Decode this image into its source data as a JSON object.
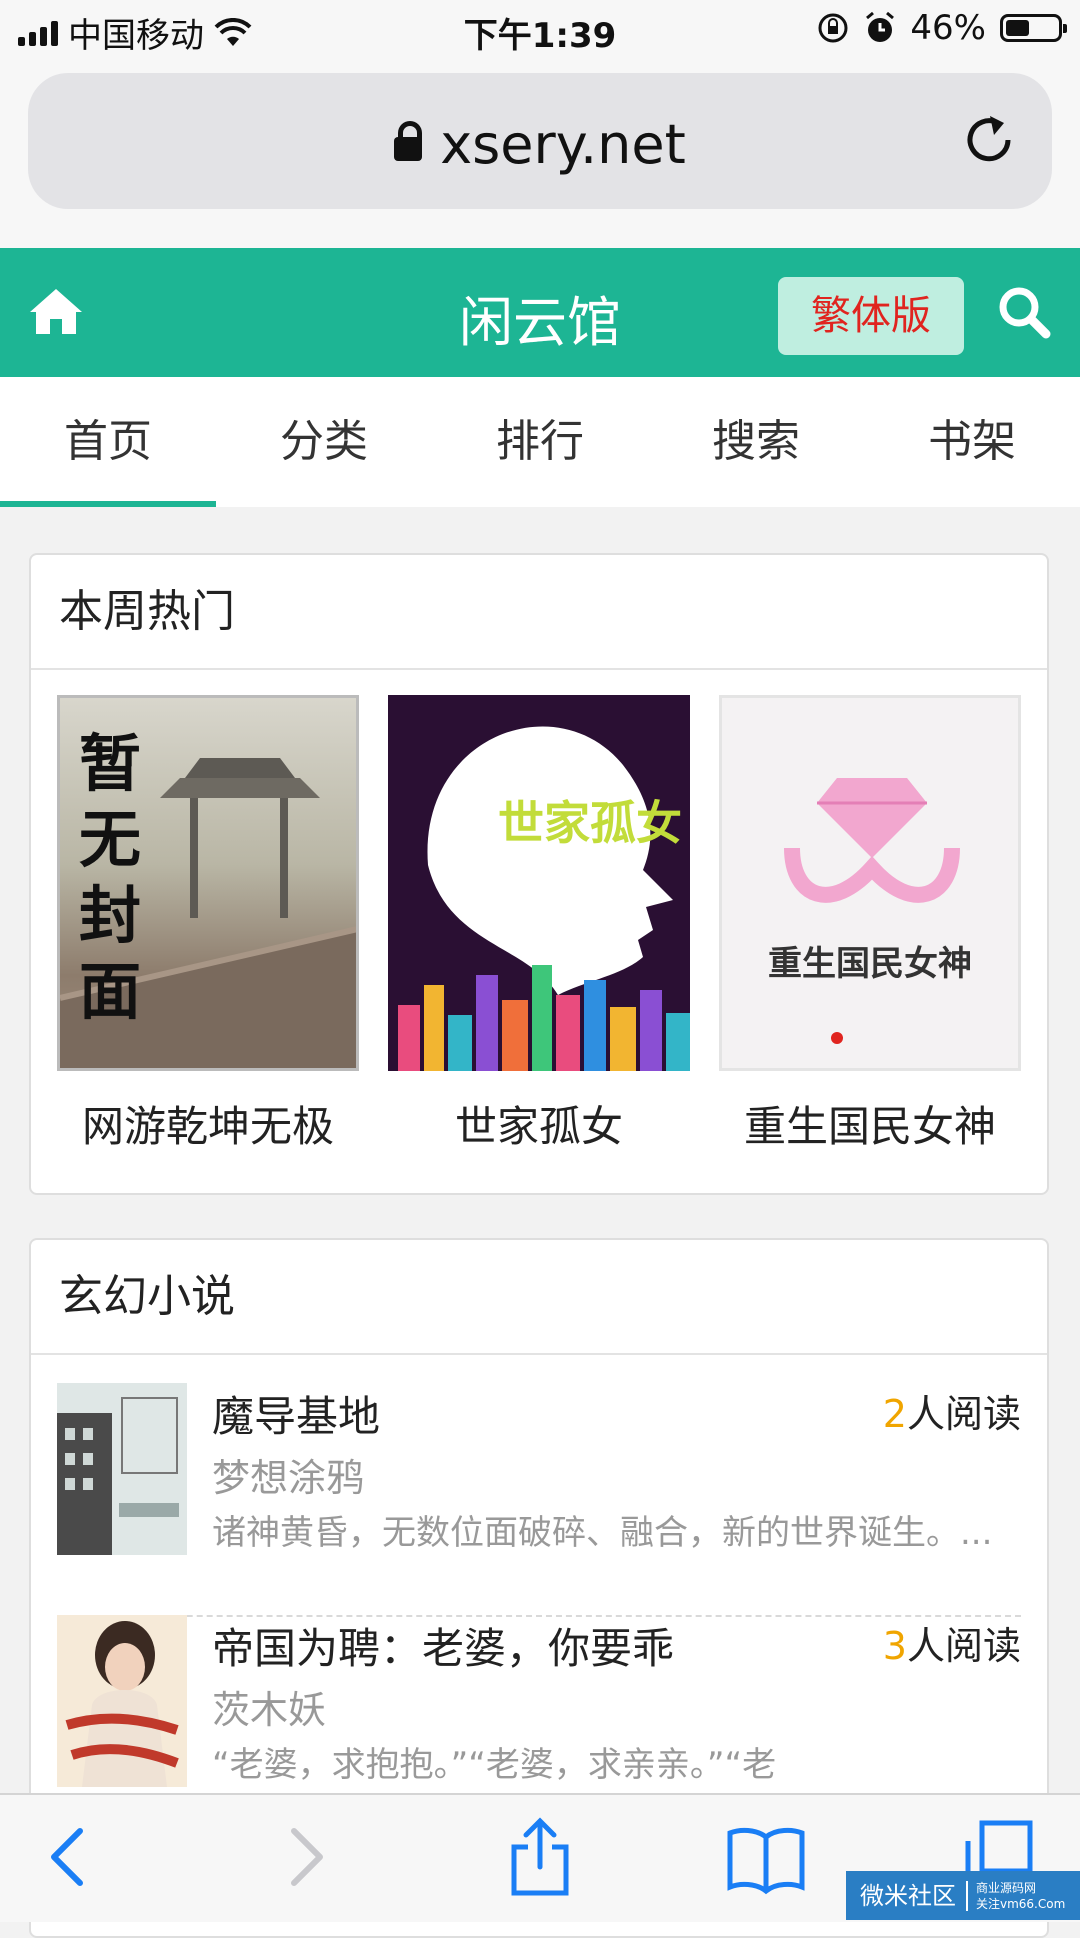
{
  "status_bar": {
    "carrier": "中国移动",
    "time": "下午1:39",
    "battery_text": "46%",
    "battery_level": 0.46
  },
  "url_bar": {
    "url": "xsery.net",
    "icons": [
      "lock-icon",
      "reload-icon"
    ]
  },
  "header": {
    "title": "闲云馆",
    "trad_button": "繁体版",
    "icons": [
      "home-icon",
      "search-icon"
    ],
    "accent_color": "#1db594"
  },
  "tabs": [
    {
      "label": "首页",
      "active": true
    },
    {
      "label": "分类",
      "active": false
    },
    {
      "label": "排行",
      "active": false
    },
    {
      "label": "搜索",
      "active": false
    },
    {
      "label": "书架",
      "active": false
    }
  ],
  "hot": {
    "heading": "本周热门",
    "items": [
      {
        "title": "网游乾坤无极",
        "cover_text": "暂无封面"
      },
      {
        "title": "世家孤女",
        "cover_text": "世家孤女"
      },
      {
        "title": "重生国民女神",
        "cover_text": "重生国民女神"
      }
    ]
  },
  "xuanhuan": {
    "heading": "玄幻小说",
    "books": [
      {
        "title": "魔导基地",
        "read_count": "2",
        "read_suffix": "人阅读",
        "author": "梦想涂鸦",
        "desc": "诸神黄昏，无数位面破碎、融合，新的世界诞生。..."
      },
      {
        "title": "帝国为聘：老婆，你要乖",
        "read_count": "3",
        "read_suffix": "人阅读",
        "author": "茨木妖",
        "desc": "“老婆，求抱抱。”“老婆，求亲亲。”“老"
      }
    ]
  },
  "toolbar": {
    "icons": [
      "back-icon",
      "forward-icon",
      "share-icon",
      "bookmarks-icon",
      "tabs-icon"
    ]
  },
  "watermark": {
    "main": "微米社区",
    "sub1": "商业源码网",
    "sub2": "关注vm66.Com"
  }
}
